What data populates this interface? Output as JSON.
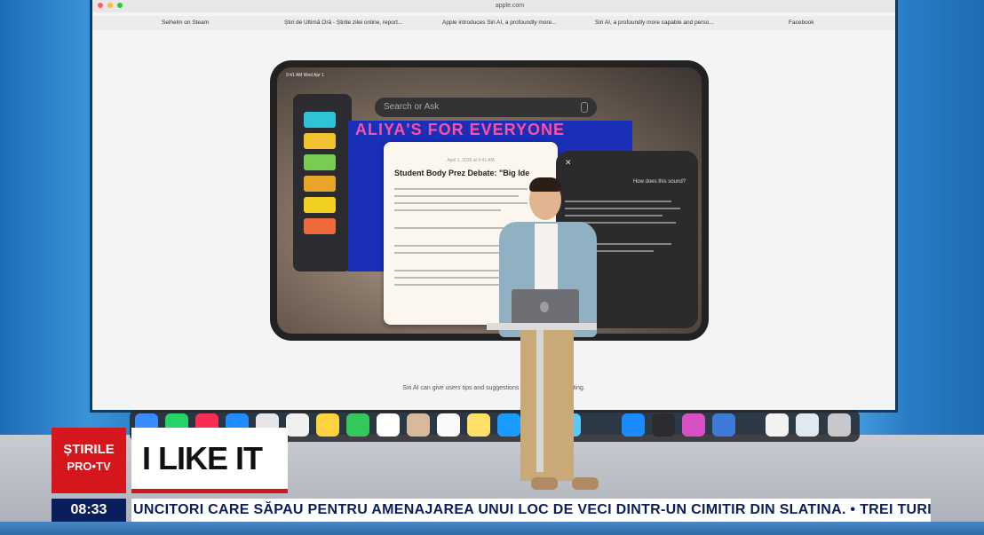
{
  "browser": {
    "url": "apple.com",
    "tabs": [
      "Selhelm on Steam",
      "Știri de Ultimă Oră - Știrile zilei online, report...",
      "Apple introduces Siri AI, a profoundly more...",
      "Siri AI, a profoundly more capable and perso...",
      "Facebook"
    ]
  },
  "ipad": {
    "status_time": "9:41 AM  Wed Apr 1",
    "search_placeholder": "Search or Ask",
    "poster_title": "ALIYA'S FOR EVERYONE",
    "doc_date": "April 1, 2026 at 9:41 AM",
    "doc_title": "Student Body Prez Debate: \"Big Ide",
    "siri_question": "How does this sound?"
  },
  "page_caption": "Siri AI can give users tips and suggestions to improve their writing.",
  "overlay": {
    "logo_line1": "ȘTIRILE",
    "logo_line2": "PRO•TV",
    "show_title": "I LIKE IT",
    "clock": "08:33",
    "ticker": "UNCITORI CARE SĂPAU PENTRU AMENAJAREA UNUI LOC DE VECI DINTR-UN CIMITIR DIN SLATINA.  •  TREI TURIȘTI, CA"
  },
  "colors": {
    "accent_red": "#d6161d",
    "ticker_navy": "#0b1e5c",
    "studio_blue": "#2f7fc4"
  }
}
